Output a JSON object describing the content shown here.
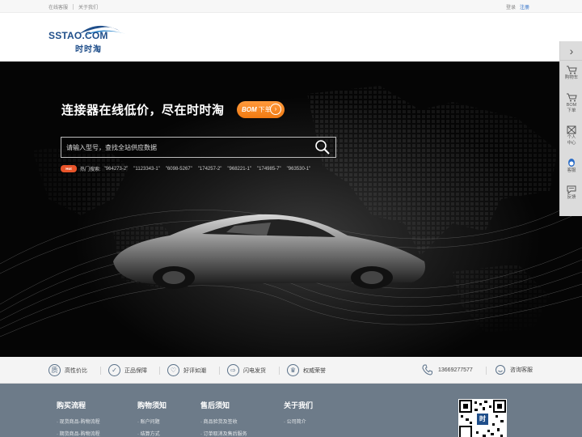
{
  "topbar": {
    "service": "在线客服",
    "about": "关于我们",
    "login": "登录",
    "register": "注册"
  },
  "logo": {
    "en": "SSTAO.COM",
    "cn": "时时淘"
  },
  "hero": {
    "slogan": "连接器在线低价，尽在时时淘",
    "bom_label": "下单",
    "bom_prefix": "BOM",
    "bom_arrow": "›",
    "search_placeholder": "请输入型号，查找全站供应数据",
    "hot_badge": "Hot",
    "hot_label": "热门搜索:",
    "hot_keywords": [
      "\"964273-2\"",
      "\"1123343-1\"",
      "\"6098-5267\"",
      "\"174257-2\"",
      "\"968221-1\"",
      "\"174985-7\"",
      "\"963530-1\""
    ]
  },
  "sidebar": {
    "arrow": "›",
    "items": [
      {
        "label": "购物车",
        "icon": "cart-icon"
      },
      {
        "label": "BOM",
        "label2": "下单",
        "icon": "bom-cart-icon"
      },
      {
        "label": "个人",
        "label2": "中心",
        "icon": "user-center-icon"
      },
      {
        "label": "客服",
        "icon": "qq-icon"
      },
      {
        "label": "反馈",
        "icon": "feedback-icon"
      }
    ]
  },
  "features": [
    {
      "label": "高性价比",
      "icon": "quality-icon",
      "glyph": "质"
    },
    {
      "label": "正品保障",
      "icon": "check-icon",
      "glyph": "✓"
    },
    {
      "label": "好评如潮",
      "icon": "thumb-icon",
      "glyph": "♡"
    },
    {
      "label": "闪电发货",
      "icon": "truck-icon",
      "glyph": "⇨"
    },
    {
      "label": "权威荣誉",
      "icon": "trophy-icon",
      "glyph": "♛"
    }
  ],
  "contact": {
    "phone": "13669277577",
    "service": "咨询客服"
  },
  "footer": {
    "cols": [
      {
        "title": "购买流程",
        "items": [
          "现货商品-购物流程",
          "期货商品-购物流程"
        ]
      },
      {
        "title": "购物须知",
        "items": [
          "账户问题",
          "结算方式"
        ]
      },
      {
        "title": "售后须知",
        "items": [
          "商品验货及签收",
          "订单取消及售后服务"
        ]
      },
      {
        "title": "关于我们",
        "items": [
          "公司简介"
        ]
      }
    ],
    "qr_char": "时"
  },
  "colors": {
    "brand": "#1f4e8a",
    "accent": "#f07a12",
    "footer": "#6d7b89"
  }
}
